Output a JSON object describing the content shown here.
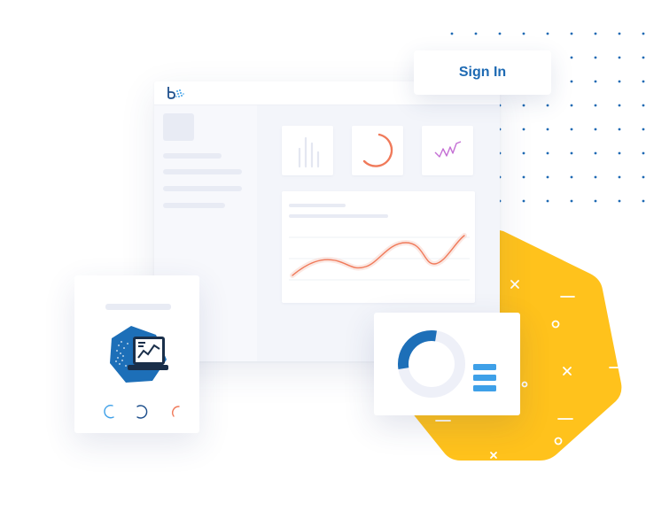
{
  "header": {
    "signin_label": "Sign In"
  },
  "colors": {
    "accent_blue": "#1e6ab3",
    "light_blue": "#3ea0e8",
    "navy": "#1d4f8c",
    "coral": "#f07a5a",
    "magenta": "#c46fd4",
    "yellow": "#ffc21c",
    "skeleton": "#e8ebf4"
  },
  "icons": {
    "logo": "brand-logo-icon",
    "bar_chart": "bar-chart-icon",
    "ring": "ring-chart-icon",
    "sparkline": "sparkline-icon",
    "dashboard_hex": "dashboard-hexagon-icon",
    "menu_lines": "menu-lines-icon"
  },
  "donut": {
    "progress_fraction": 0.3
  }
}
